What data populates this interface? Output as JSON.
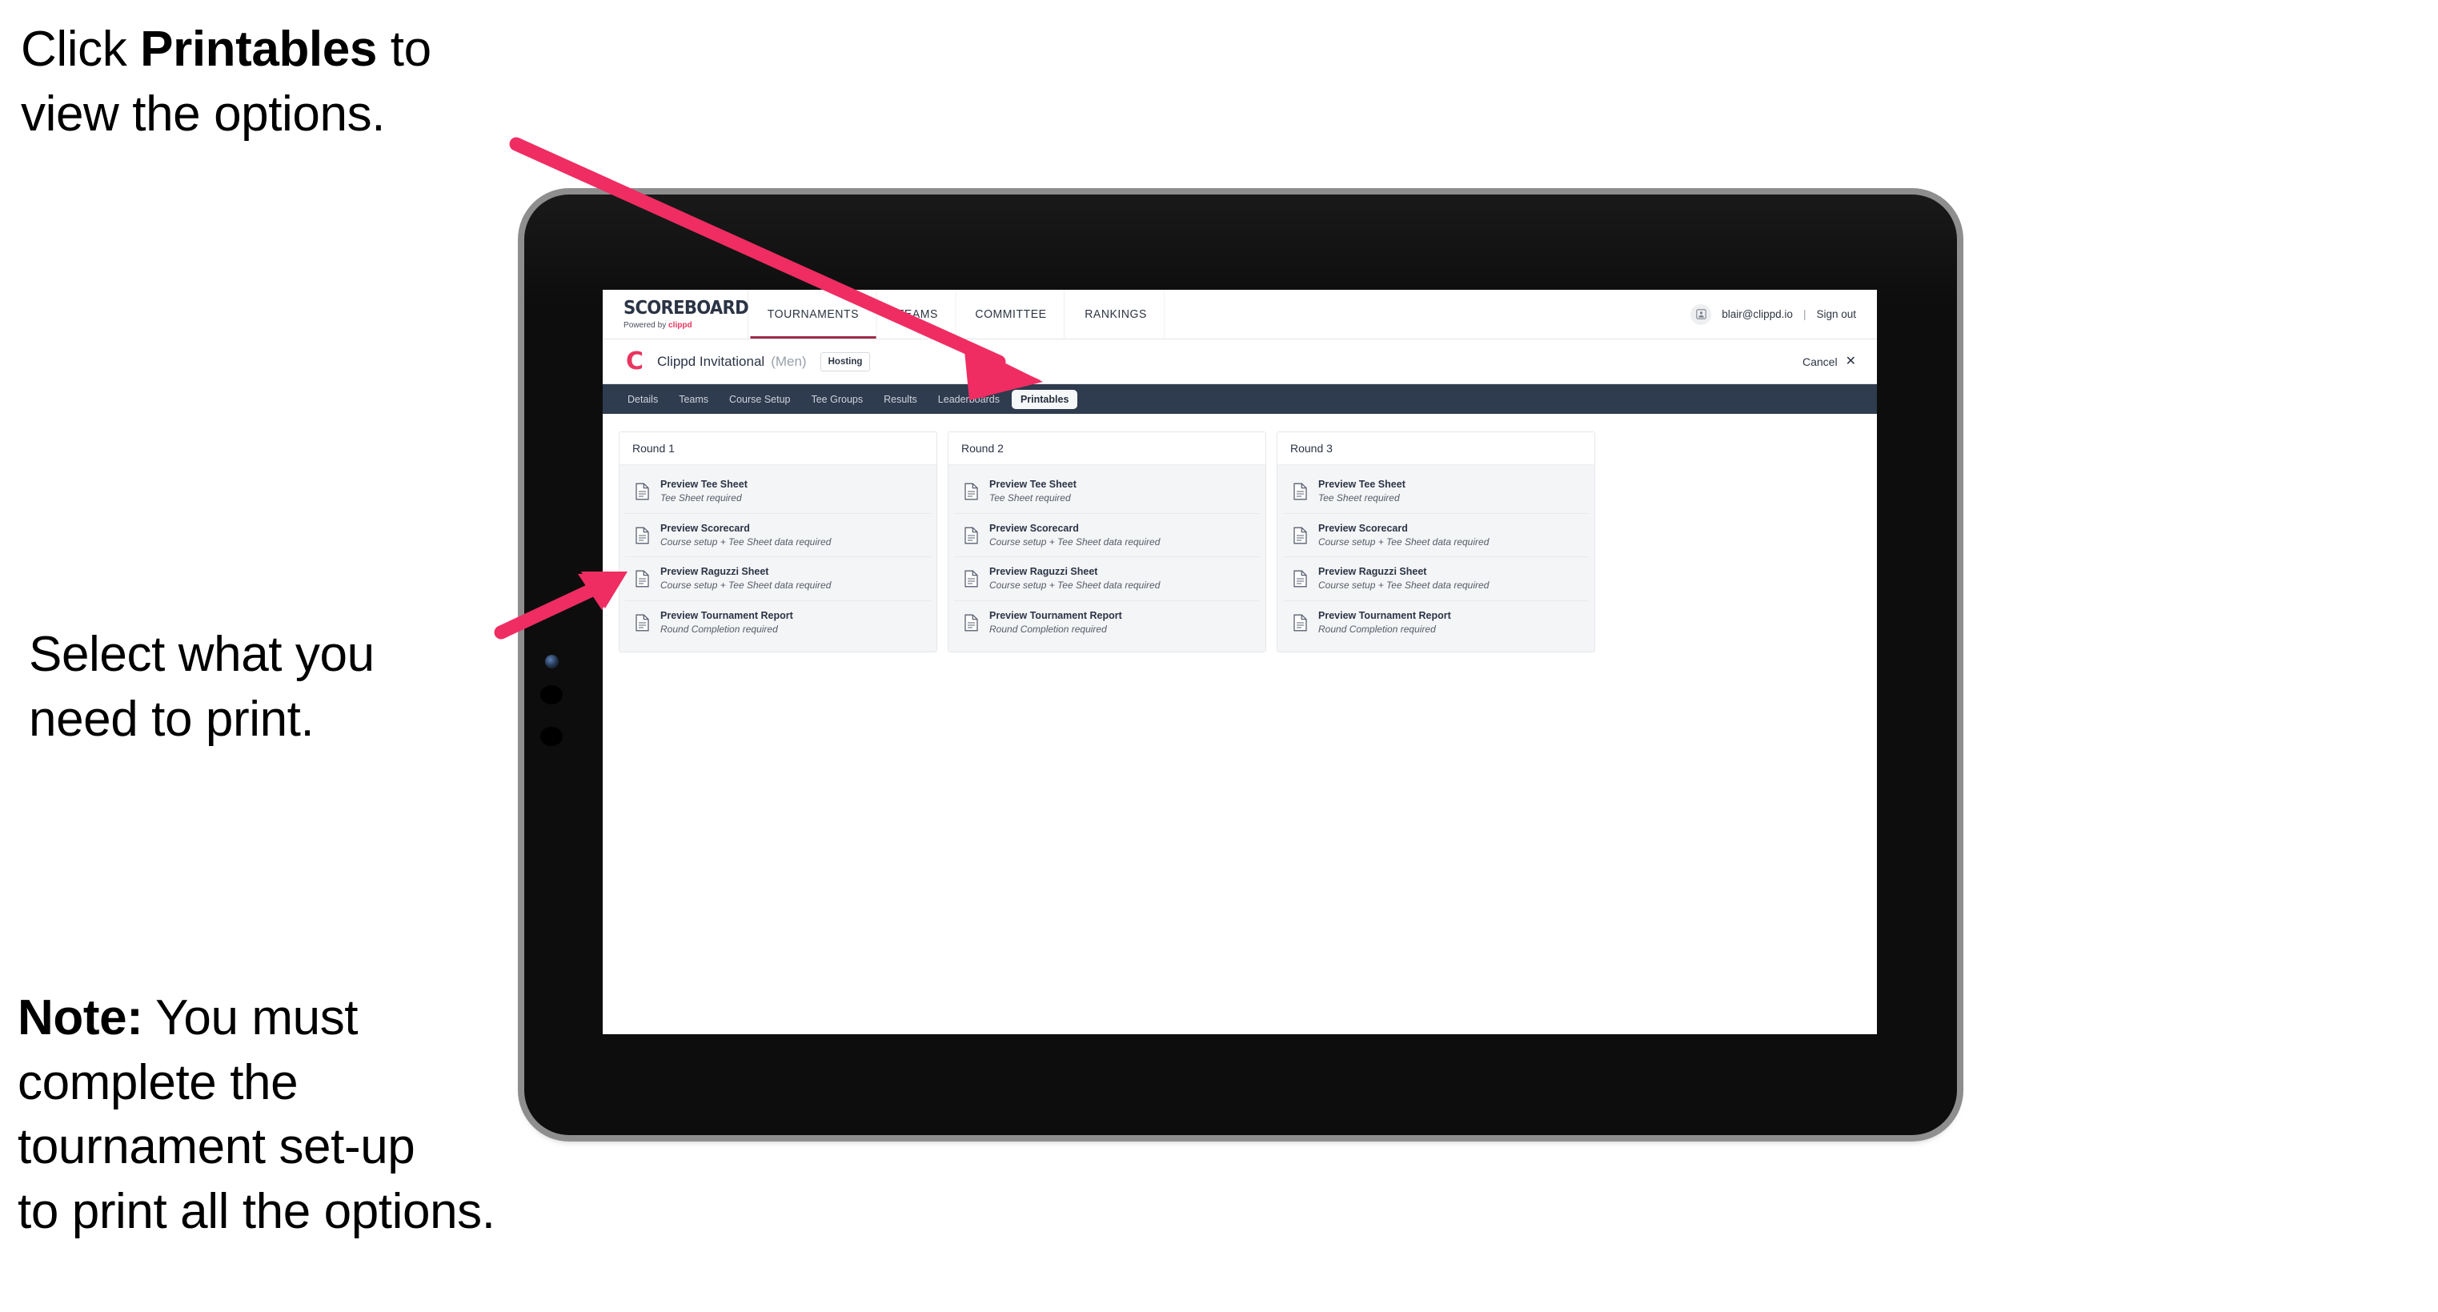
{
  "annotations": {
    "top_prefix": "Click ",
    "top_bold": "Printables",
    "top_suffix": " to\nview the options.",
    "middle": "Select what you\n need to print.",
    "note_bold": "Note:",
    "note_rest": " You must\ncomplete the\ntournament set-up\nto print all the options."
  },
  "colors": {
    "accent_pink": "#ef2d62",
    "brand_pink": "#e8355f",
    "tabstrip_dark": "#2f3b4e",
    "nav_underline": "#9d2d4a",
    "card_bg": "#f4f5f7"
  },
  "app": {
    "brand": {
      "wordmark": "SCOREBOARD",
      "powered_prefix": "Powered by ",
      "powered_brand": "clippd"
    },
    "nav": [
      {
        "label": "TOURNAMENTS",
        "active": true
      },
      {
        "label": "TEAMS",
        "active": false
      },
      {
        "label": "COMMITTEE",
        "active": false
      },
      {
        "label": "RANKINGS",
        "active": false
      }
    ],
    "account": {
      "avatar_icon": "user-avatar-icon",
      "email": "blair@clippd.io",
      "separator": "|",
      "sign_out": "Sign out"
    },
    "subheader": {
      "logo_glyph": "C",
      "tournament_name": "Clippd Invitational",
      "gender": "(Men)",
      "role_badge": "Hosting",
      "cancel_label": "Cancel",
      "cancel_icon": "close-icon"
    },
    "tabs": [
      {
        "label": "Details",
        "selected": false
      },
      {
        "label": "Teams",
        "selected": false
      },
      {
        "label": "Course Setup",
        "selected": false
      },
      {
        "label": "Tee Groups",
        "selected": false
      },
      {
        "label": "Results",
        "selected": false
      },
      {
        "label": "Leaderboards",
        "selected": false
      },
      {
        "label": "Printables",
        "selected": true
      }
    ],
    "printables": {
      "rounds": [
        {
          "title": "Round 1",
          "documents": [
            {
              "title": "Preview Tee Sheet",
              "requirement": "Tee Sheet required",
              "icon": "document-icon"
            },
            {
              "title": "Preview Scorecard",
              "requirement": "Course setup + Tee Sheet data required",
              "icon": "document-icon"
            },
            {
              "title": "Preview Raguzzi Sheet",
              "requirement": "Course setup + Tee Sheet data required",
              "icon": "document-icon"
            },
            {
              "title": "Preview Tournament Report",
              "requirement": "Round Completion required",
              "icon": "document-icon"
            }
          ]
        },
        {
          "title": "Round 2",
          "documents": [
            {
              "title": "Preview Tee Sheet",
              "requirement": "Tee Sheet required",
              "icon": "document-icon"
            },
            {
              "title": "Preview Scorecard",
              "requirement": "Course setup + Tee Sheet data required",
              "icon": "document-icon"
            },
            {
              "title": "Preview Raguzzi Sheet",
              "requirement": "Course setup + Tee Sheet data required",
              "icon": "document-icon"
            },
            {
              "title": "Preview Tournament Report",
              "requirement": "Round Completion required",
              "icon": "document-icon"
            }
          ]
        },
        {
          "title": "Round 3",
          "documents": [
            {
              "title": "Preview Tee Sheet",
              "requirement": "Tee Sheet required",
              "icon": "document-icon"
            },
            {
              "title": "Preview Scorecard",
              "requirement": "Course setup + Tee Sheet data required",
              "icon": "document-icon"
            },
            {
              "title": "Preview Raguzzi Sheet",
              "requirement": "Course setup + Tee Sheet data required",
              "icon": "document-icon"
            },
            {
              "title": "Preview Tournament Report",
              "requirement": "Round Completion required",
              "icon": "document-icon"
            }
          ]
        }
      ]
    }
  }
}
